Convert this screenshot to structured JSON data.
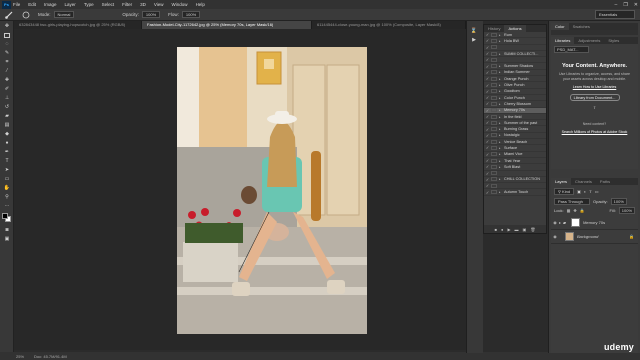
{
  "menubar": {
    "logo": "Ps",
    "items": [
      "File",
      "Edit",
      "Image",
      "Layer",
      "Type",
      "Select",
      "Filter",
      "3D",
      "View",
      "Window",
      "Help"
    ],
    "window_controls": [
      "–",
      "❐",
      "✕"
    ]
  },
  "optbar": {
    "mode_label": "Mode:",
    "mode_value": "Normal",
    "opacity_label": "Opacity:",
    "opacity_value": "100%",
    "flow_label": "Flow:",
    "flow_value": "100%",
    "workspace": "Essentials"
  },
  "tabs": [
    {
      "label": "632843448 two-girls-playing-hopscotch.jpg @ 25% (RGB/8)",
      "active": false
    },
    {
      "label": "Fashion-Model-City-1172642.jpg @ 25% (Memory 70s, Layer Mask/16)",
      "active": true
    },
    {
      "label": "611445444-close-young-man.jpg @ 100% (Composite, Layer Mask/8)",
      "active": false
    }
  ],
  "status": {
    "zoom": "25%",
    "doc": "Doc: 45.7M/91.4M"
  },
  "actions": {
    "tabs": [
      "History",
      "Actions"
    ],
    "active_tab": "Actions",
    "items": [
      {
        "label": "Rum",
        "checked": true,
        "group": false
      },
      {
        "label": "Hola BW",
        "checked": true,
        "group": false
      },
      {
        "label": "",
        "checked": true,
        "group": false
      },
      {
        "label": "SUMM COLLECTI...",
        "checked": true,
        "group": true
      },
      {
        "label": "",
        "checked": true,
        "group": false
      },
      {
        "label": "Summer Shadow",
        "checked": true,
        "group": false
      },
      {
        "label": "Indian Summer",
        "checked": true,
        "group": false
      },
      {
        "label": "Orange Punch",
        "checked": true,
        "group": false
      },
      {
        "label": "Olive Punch",
        "checked": true,
        "group": false
      },
      {
        "label": "Goodtom",
        "checked": true,
        "group": false
      },
      {
        "label": "Color Punch",
        "checked": true,
        "group": false
      },
      {
        "label": "Cherry Blossom",
        "checked": true,
        "group": false
      },
      {
        "label": "Memory 70s",
        "checked": true,
        "group": false,
        "selected": true
      },
      {
        "label": "In the field",
        "checked": true,
        "group": false
      },
      {
        "label": "Summer of the past",
        "checked": true,
        "group": false
      },
      {
        "label": "Burning Grass",
        "checked": true,
        "group": false
      },
      {
        "label": "Nostalgic",
        "checked": true,
        "group": false
      },
      {
        "label": "Venice Beach",
        "checked": true,
        "group": false
      },
      {
        "label": "Surface",
        "checked": true,
        "group": false
      },
      {
        "label": "Miami Vice",
        "checked": true,
        "group": false
      },
      {
        "label": "That Year",
        "checked": true,
        "group": false
      },
      {
        "label": "Soft Blast",
        "checked": true,
        "group": false
      },
      {
        "label": "",
        "checked": true,
        "group": false
      },
      {
        "label": "CHILL COLLECTION",
        "checked": true,
        "group": true
      },
      {
        "label": "",
        "checked": true,
        "group": false
      },
      {
        "label": "Autumn Touch",
        "checked": true,
        "group": false
      }
    ],
    "footer_icons": [
      "■",
      "●",
      "▶",
      "▬",
      "▣",
      "🗑"
    ]
  },
  "color_panel": {
    "tabs": [
      "Color",
      "Swatches"
    ]
  },
  "libraries": {
    "tabs": [
      "Libraries",
      "Adjustments",
      "Styles"
    ],
    "dropdown": "PSD_MAT...",
    "headline": "Your Content. Anywhere.",
    "body": "Use Libraries to organize, access, and share your assets across desktop and mobile.",
    "link": "Learn How to Use Libraries",
    "button": "Library from Document...",
    "need_content": "Need content?",
    "stock_link": "Search Millions of Photos at Adobe Stock"
  },
  "layers": {
    "tabs": [
      "Layers",
      "Channels",
      "Paths"
    ],
    "kind_label": "Kind",
    "blend_mode": "Pass Through",
    "opacity_label": "Opacity:",
    "opacity_value": "100%",
    "lock_label": "Lock:",
    "fill_label": "Fill:",
    "fill_value": "100%",
    "rows": [
      {
        "name": "Memory 70s",
        "type": "group"
      },
      {
        "name": "Background",
        "type": "image"
      }
    ]
  },
  "watermark": "udemy"
}
